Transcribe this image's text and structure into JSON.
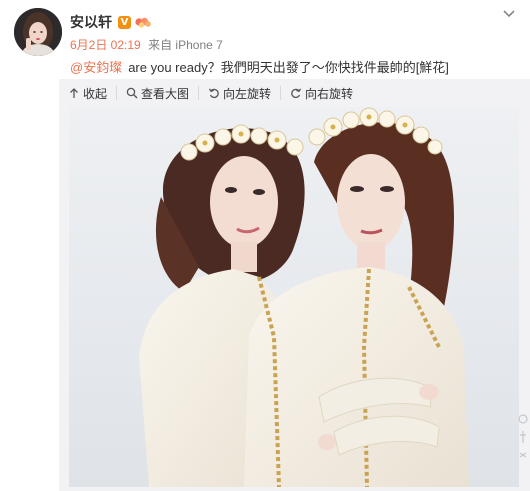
{
  "user": {
    "name": "安以轩",
    "verified_badge": "V",
    "avatar": "avatar-photo"
  },
  "meta": {
    "date": "6月2日 02:19",
    "source_prefix": "来自",
    "source_device": "iPhone 7"
  },
  "post": {
    "mention": "@安鈞璨",
    "body": "are you ready？我們明天出發了～你快找件最帥的[鮮花]"
  },
  "toolbar": {
    "collapse_label": "收起",
    "view_large_label": "查看大图",
    "rotate_left_label": "向左旋转",
    "rotate_right_label": "向右旋转"
  },
  "photo": {
    "description_icon": "photo-two-women-flower-crowns"
  },
  "colors": {
    "accent": "#eb7350",
    "verified": "#f29111",
    "text": "#333333",
    "meta": "#808080",
    "media_bg": "#f2f2f5"
  }
}
